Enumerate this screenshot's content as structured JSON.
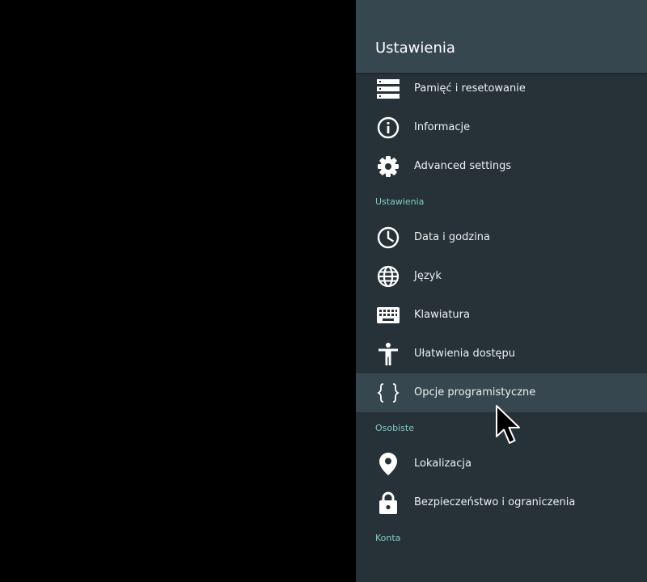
{
  "panel": {
    "title": "Ustawienia"
  },
  "items_top": [
    {
      "label": "Pamięć i resetowanie",
      "icon": "storage-icon"
    },
    {
      "label": "Informacje",
      "icon": "info-icon"
    },
    {
      "label": "Advanced settings",
      "icon": "gear-icon"
    }
  ],
  "section_ustawienia": {
    "header": "Ustawienia",
    "items": [
      {
        "label": "Data i godzina",
        "icon": "clock-icon"
      },
      {
        "label": "Język",
        "icon": "globe-icon"
      },
      {
        "label": "Klawiatura",
        "icon": "keyboard-icon"
      },
      {
        "label": "Ułatwienia dostępu",
        "icon": "accessibility-icon"
      },
      {
        "label": "Opcje programistyczne",
        "icon": "braces-icon",
        "focused": true
      }
    ]
  },
  "section_osobiste": {
    "header": "Osobiste",
    "items": [
      {
        "label": "Lokalizacja",
        "icon": "location-pin-icon"
      },
      {
        "label": "Bezpieczeństwo i ograniczenia",
        "icon": "lock-icon"
      }
    ]
  },
  "section_konta": {
    "header": "Konta"
  },
  "colors": {
    "background": "#000000",
    "panel": "#263238",
    "header": "#37474f",
    "focus": "#37474f",
    "text": "#eceff1",
    "section_accent": "#80cbc4"
  }
}
